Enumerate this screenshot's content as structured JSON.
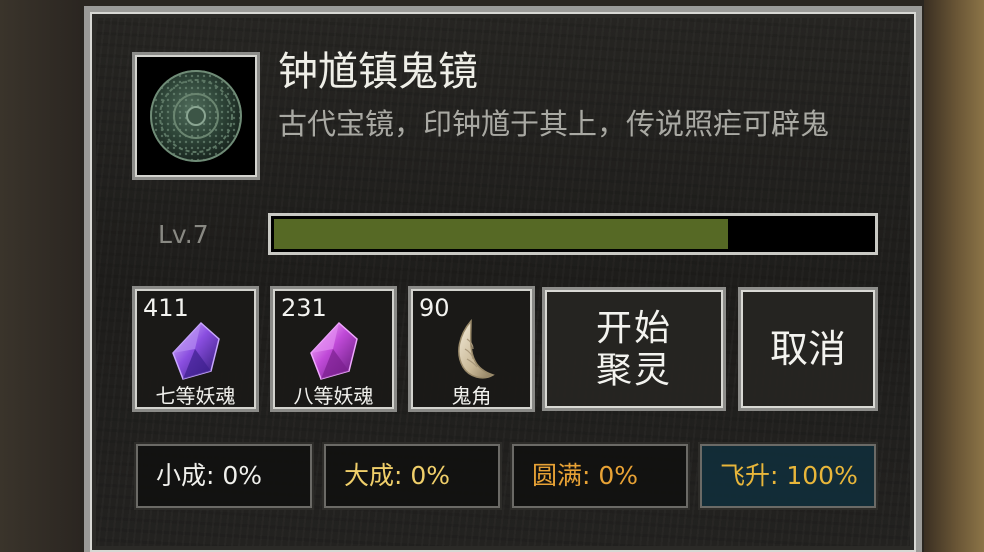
{
  "item": {
    "title": "钟馗镇鬼镜",
    "description": "古代宝镜，印钟馗于其上，传说照疟可辟鬼",
    "icon": "bronze-mirror-icon"
  },
  "level": {
    "label": "Lv.7",
    "progress": 0.76,
    "fill_color": "#566925"
  },
  "materials": [
    {
      "count": "411",
      "name": "七等妖魂",
      "icon": "blue-crystal-icon"
    },
    {
      "count": "231",
      "name": "八等妖魂",
      "icon": "magenta-crystal-icon"
    },
    {
      "count": "90",
      "name": "鬼角",
      "icon": "horn-icon"
    }
  ],
  "buttons": {
    "start_line1": "开始",
    "start_line2": "聚灵",
    "cancel": "取消"
  },
  "stats": [
    {
      "label": "小成: 0%",
      "color": "#f0f0ec"
    },
    {
      "label": "大成: 0%",
      "color": "#f0cf6a"
    },
    {
      "label": "圆满: 0%",
      "color": "#e8a235"
    },
    {
      "label": "飞升: 100%",
      "color": "#e8b63a"
    }
  ]
}
